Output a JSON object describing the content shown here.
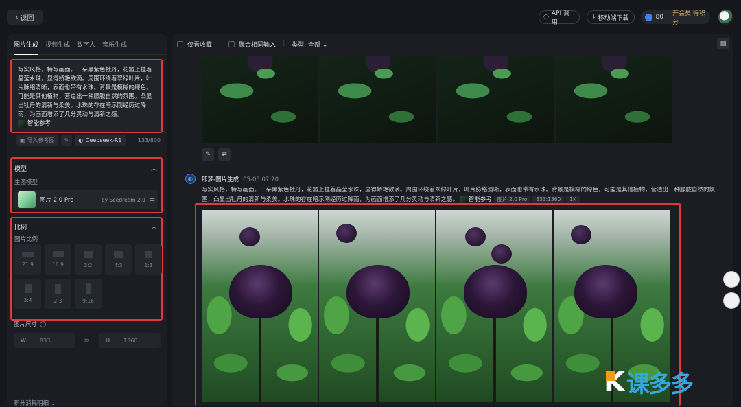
{
  "header": {
    "back_label": "返回",
    "api_label": "API 调用",
    "mobile_label": "移动端下载",
    "credits": "80",
    "vip_label": "开会员 得积分"
  },
  "left": {
    "tabs": [
      "图片生成",
      "视频生成",
      "数字人",
      "音乐生成"
    ],
    "prompt_text": "写实风格，特写画面。一朵黑紫色牡丹，花瓣上挂着晶莹水珠，显得娇艳欲滴。周围环绕着翠绿叶片，叶片脉络清晰，表面也带有水珠。背景是模糊的绿色，可能是其他植物，营造出一种朦胧自然的氛围。凸显出牡丹的清新与柔美。水珠的存在暗示刚经历过降雨，为画面增添了几分灵动与清新之感。",
    "smart_ref": "智能参考",
    "import_ref": "导入参考图",
    "deepseek": "Deepseek-R1",
    "char_count": "133/800",
    "model_title": "模型",
    "gen_model_label": "生图模型",
    "model_name": "图片 2.0 Pro",
    "model_by": "by Seedream 2.0",
    "ratio_title": "比例",
    "ratio_label": "图片比例",
    "ratios": [
      "21:9",
      "16:9",
      "3:2",
      "4:3",
      "1:1",
      "3:4",
      "2:3",
      "9:16"
    ],
    "size_label": "图片尺寸",
    "w_label": "W",
    "w_value": "833",
    "h_label": "H",
    "h_value": "1360",
    "footer": "积分消耗明细"
  },
  "main": {
    "filter_fav": "仅看收藏",
    "filter_same": "聚合相同输入",
    "filter_type": "类型: 全部",
    "msg_title": "即梦-图片生成",
    "msg_time": "05-05  07:20",
    "msg_text": "写实风格，特写画面。一朵黑紫色牡丹，花瓣上挂着晶莹水珠，显得娇艳欲滴。周围环绕着翠绿叶片，叶片脉络清晰，表面也带有水珠。背景是模糊的绿色，可能是其他植物，营造出一种朦胧自然的氛围，凸显出牡丹的清新与柔美。水珠的存在暗示刚经历过降雨，为画面增添了几分灵动与清新之感。",
    "msg_ref": "智能参考",
    "tags": [
      "图片 2.0 Pro",
      "833:1360",
      "1K"
    ]
  },
  "watermark": "课多多",
  "icons": [
    "back-icon",
    "api-icon",
    "download-icon",
    "credit-icon",
    "edit-icon",
    "regenerate-icon",
    "folder-icon",
    "link-icon",
    "info-icon",
    "chevron-up-icon",
    "settings-icon"
  ]
}
